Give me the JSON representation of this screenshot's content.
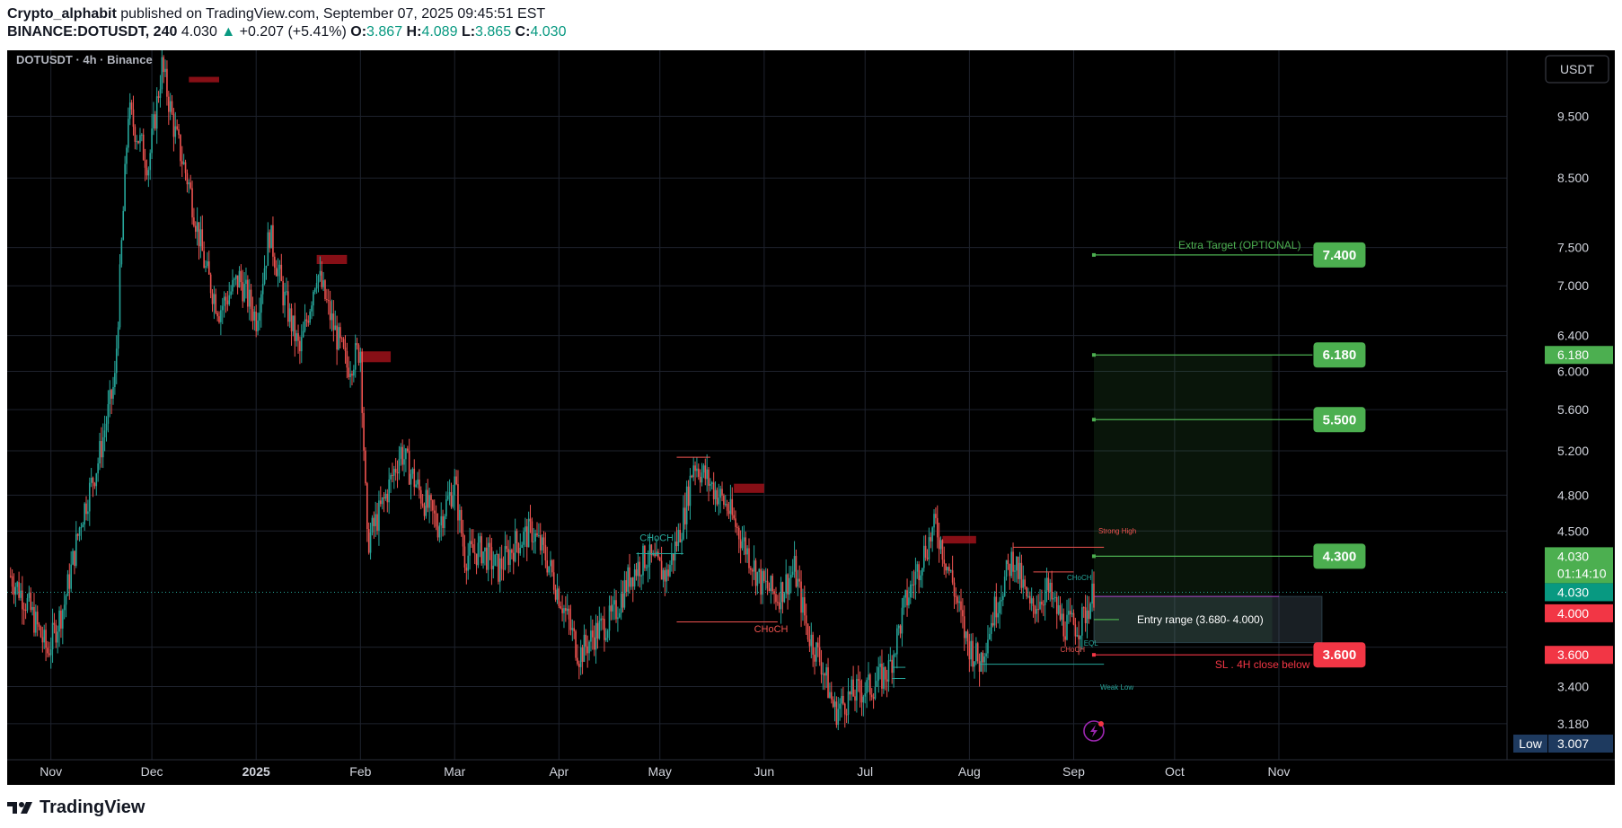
{
  "header": {
    "author": "Crypto_alphabit",
    "published": "published on TradingView.com, September 07, 2025 09:45:51 EST",
    "symbol": "BINANCE:DOTUSDT, 240",
    "last": "4.030",
    "change": "+0.207 (+5.41%)",
    "o_label": "O:",
    "o": "3.867",
    "h_label": "H:",
    "h": "4.089",
    "l_label": "L:",
    "l": "3.865",
    "c_label": "C:",
    "c": "4.030"
  },
  "chart_data": {
    "type": "candlestick",
    "title": "DOTUSDT · 4h · Binance",
    "currency": "USDT",
    "scale": "log",
    "ylim": [
      2.98,
      10.7
    ],
    "grid": true,
    "x_ticks": [
      "Nov",
      "Dec",
      "2025",
      "Feb",
      "Mar",
      "Apr",
      "May",
      "Jun",
      "Jul",
      "Aug",
      "Sep",
      "Oct",
      "Nov"
    ],
    "y_ticks": [
      "9.500",
      "8.500",
      "7.500",
      "7.000",
      "6.400",
      "6.000",
      "5.600",
      "5.200",
      "4.800",
      "4.500",
      "3.400",
      "3.180"
    ],
    "price_path": [
      [
        "2024-10-20",
        4.15
      ],
      [
        "2024-10-25",
        3.95
      ],
      [
        "2024-10-31",
        3.62
      ],
      [
        "2024-11-05",
        3.95
      ],
      [
        "2024-11-10",
        4.6
      ],
      [
        "2024-11-15",
        5.1
      ],
      [
        "2024-11-20",
        5.9
      ],
      [
        "2024-11-24",
        9.6
      ],
      [
        "2024-11-30",
        8.7
      ],
      [
        "2024-12-04",
        10.4
      ],
      [
        "2024-12-08",
        9.2
      ],
      [
        "2024-12-12",
        8.4
      ],
      [
        "2024-12-17",
        7.2
      ],
      [
        "2024-12-21",
        6.7
      ],
      [
        "2024-12-27",
        7.1
      ],
      [
        "2025-01-01",
        6.6
      ],
      [
        "2025-01-05",
        7.7
      ],
      [
        "2025-01-09",
        6.9
      ],
      [
        "2025-01-14",
        6.2
      ],
      [
        "2025-01-19",
        7.2
      ],
      [
        "2025-01-24",
        6.5
      ],
      [
        "2025-01-28",
        6.05
      ],
      [
        "2025-02-01",
        6.25
      ],
      [
        "2025-02-03",
        4.4
      ],
      [
        "2025-02-08",
        4.75
      ],
      [
        "2025-02-13",
        5.2
      ],
      [
        "2025-02-19",
        4.8
      ],
      [
        "2025-02-24",
        4.55
      ],
      [
        "2025-03-01",
        4.9
      ],
      [
        "2025-03-04",
        4.3
      ],
      [
        "2025-03-09",
        4.35
      ],
      [
        "2025-03-14",
        4.2
      ],
      [
        "2025-03-19",
        4.4
      ],
      [
        "2025-03-24",
        4.5
      ],
      [
        "2025-03-28",
        4.3
      ],
      [
        "2025-04-02",
        3.95
      ],
      [
        "2025-04-07",
        3.6
      ],
      [
        "2025-04-12",
        3.75
      ],
      [
        "2025-04-17",
        3.85
      ],
      [
        "2025-04-22",
        4.15
      ],
      [
        "2025-04-27",
        4.3
      ],
      [
        "2025-05-03",
        4.15
      ],
      [
        "2025-05-08",
        4.6
      ],
      [
        "2025-05-11",
        5.1
      ],
      [
        "2025-05-16",
        4.9
      ],
      [
        "2025-05-21",
        4.7
      ],
      [
        "2025-05-26",
        4.4
      ],
      [
        "2025-05-31",
        4.1
      ],
      [
        "2025-06-05",
        4.0
      ],
      [
        "2025-06-10",
        4.2
      ],
      [
        "2025-06-14",
        3.75
      ],
      [
        "2025-06-18",
        3.55
      ],
      [
        "2025-06-22",
        3.25
      ],
      [
        "2025-06-27",
        3.35
      ],
      [
        "2025-07-03",
        3.4
      ],
      [
        "2025-07-08",
        3.5
      ],
      [
        "2025-07-13",
        3.95
      ],
      [
        "2025-07-18",
        4.3
      ],
      [
        "2025-07-22",
        4.55
      ],
      [
        "2025-07-27",
        4.1
      ],
      [
        "2025-07-31",
        3.7
      ],
      [
        "2025-08-04",
        3.55
      ],
      [
        "2025-08-09",
        3.95
      ],
      [
        "2025-08-14",
        4.3
      ],
      [
        "2025-08-19",
        3.9
      ],
      [
        "2025-08-24",
        4.05
      ],
      [
        "2025-08-29",
        3.8
      ],
      [
        "2025-09-03",
        3.8
      ],
      [
        "2025-09-07",
        4.03
      ]
    ],
    "supply_zones": [
      {
        "start": "2024-12-12",
        "end": "2024-12-21",
        "low": 10.1,
        "high": 10.2
      },
      {
        "start": "2025-01-19",
        "end": "2025-01-28",
        "low": 7.28,
        "high": 7.4
      },
      {
        "start": "2025-02-01",
        "end": "2025-02-10",
        "low": 6.1,
        "high": 6.22
      },
      {
        "start": "2025-05-23",
        "end": "2025-06-01",
        "low": 4.82,
        "high": 4.9
      },
      {
        "start": "2025-07-24",
        "end": "2025-08-03",
        "low": 4.4,
        "high": 4.46
      }
    ],
    "structure_labels": [
      {
        "text": "CHoCH",
        "date": "2025-04-25",
        "price": 4.42,
        "color": "#26a69a"
      },
      {
        "text": "CHoCH",
        "date": "2025-05-29",
        "price": 3.75,
        "color": "#ef5350"
      }
    ],
    "levels": [
      {
        "date": "2025-08-14",
        "end": "2025-09-10",
        "price": 4.37,
        "color": "#ef5350"
      },
      {
        "date": "2025-08-20",
        "end": "2025-09-01",
        "price": 4.18,
        "color": "#ef5350"
      },
      {
        "date": "2025-07-09",
        "end": "2025-07-13",
        "price": 3.52,
        "color": "#26a69a"
      },
      {
        "date": "2025-07-09",
        "end": "2025-07-13",
        "price": 3.45,
        "color": "#26a69a"
      },
      {
        "date": "2025-08-04",
        "end": "2025-09-10",
        "price": 3.54,
        "color": "#26a69a"
      },
      {
        "date": "2025-05-06",
        "end": "2025-05-16",
        "price": 5.14,
        "color": "#ef5350"
      }
    ],
    "small_labels": {
      "strong_high": "Strong High",
      "weak_low": "Weak Low",
      "choch_green": "CHoCH",
      "choch_red": "CHoCH",
      "eql": "EQL"
    },
    "trade": {
      "entry_date": "2025-09-07",
      "end_date": "2025-11-01",
      "target_zone_end": "2025-10-30",
      "entry_low": 3.68,
      "entry_high": 4.0,
      "entry_text": "Entry range   (3.680- 4.000)",
      "sl": 3.6,
      "sl_text": "SL . 4H close below",
      "targets": [
        {
          "price": 7.4,
          "label": "7.400",
          "note": "Extra Target (OPTIONAL)"
        },
        {
          "price": 6.18,
          "label": "6.180",
          "note": ""
        },
        {
          "price": 5.5,
          "label": "5.500",
          "note": ""
        },
        {
          "price": 4.3,
          "label": "4.300",
          "note": ""
        }
      ],
      "sl_label": "3.600"
    },
    "axis_badges": {
      "target": "6.180",
      "current": "4.030",
      "countdown": "01:14:10",
      "last_price": "4.030",
      "entry": "4.000",
      "sl": "3.600",
      "low_label": "Low",
      "low": "3.007"
    },
    "colors": {
      "up": "#26a69a",
      "down": "#ef5350",
      "green_label": "#4caf50",
      "red_label": "#f23645",
      "grid": "#1e222d"
    }
  },
  "footer": {
    "brand": "TradingView"
  }
}
